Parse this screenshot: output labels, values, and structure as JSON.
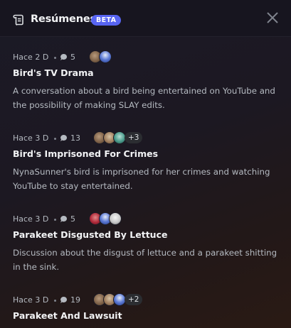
{
  "header": {
    "title": "Resúmenes",
    "badge": "BETA",
    "icon": "scroll-icon",
    "close_icon": "close-icon"
  },
  "summaries": [
    {
      "when": "Hace 2 D",
      "count": "5",
      "title": "Bird's TV Drama",
      "description": "A conversation about a bird being entertained on YouTube and the possibility of making SLAY edits.",
      "more": ""
    },
    {
      "when": "Hace 3 D",
      "count": "13",
      "title": "Bird's Imprisoned For Crimes",
      "description": "NynaSunner's bird is imprisoned for her crimes and watching YouTube to stay entertained.",
      "more": "+3"
    },
    {
      "when": "Hace 3 D",
      "count": "5",
      "title": "Parakeet Disgusted By Lettuce",
      "description": "Discussion about the disgust of lettuce and a parakeet shitting in the sink.",
      "more": ""
    },
    {
      "when": "Hace 3 D",
      "count": "19",
      "title": "Parakeet And Lawsuit",
      "description": "",
      "more": "+2"
    }
  ],
  "colors": {
    "accent": "#5865f2",
    "header_bg": "#17151f",
    "title": "#f2f3f5",
    "muted": "#b5bac1"
  }
}
